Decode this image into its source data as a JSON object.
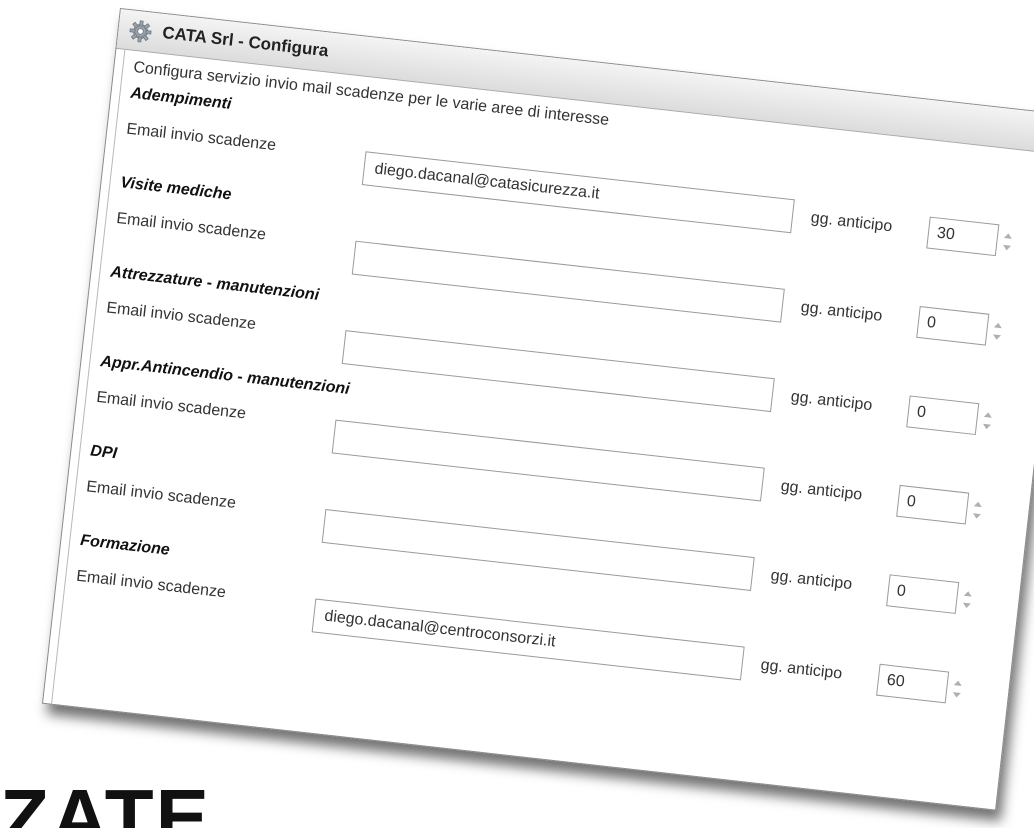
{
  "window": {
    "title": "CATA Srl - Configura",
    "icon": "gear-icon"
  },
  "description": "Configura servizio invio mail scadenze per le varie aree di interesse",
  "email_label": "Email invio scadenze",
  "days_label": "gg. anticipo",
  "sections": [
    {
      "title": "Adempimenti",
      "email": "diego.dacanal@catasicurezza.it",
      "days": "30"
    },
    {
      "title": "Visite mediche",
      "email": "",
      "days": "0"
    },
    {
      "title": "Attrezzature - manutenzioni",
      "email": "",
      "days": "0"
    },
    {
      "title": "Appr.Antincendio - manutenzioni",
      "email": "",
      "days": "0"
    },
    {
      "title": "DPI",
      "email": "",
      "days": "0"
    },
    {
      "title": "Formazione",
      "email": "diego.dacanal@centroconsorzi.it",
      "days": "60"
    }
  ],
  "background_heading": "ZATE"
}
